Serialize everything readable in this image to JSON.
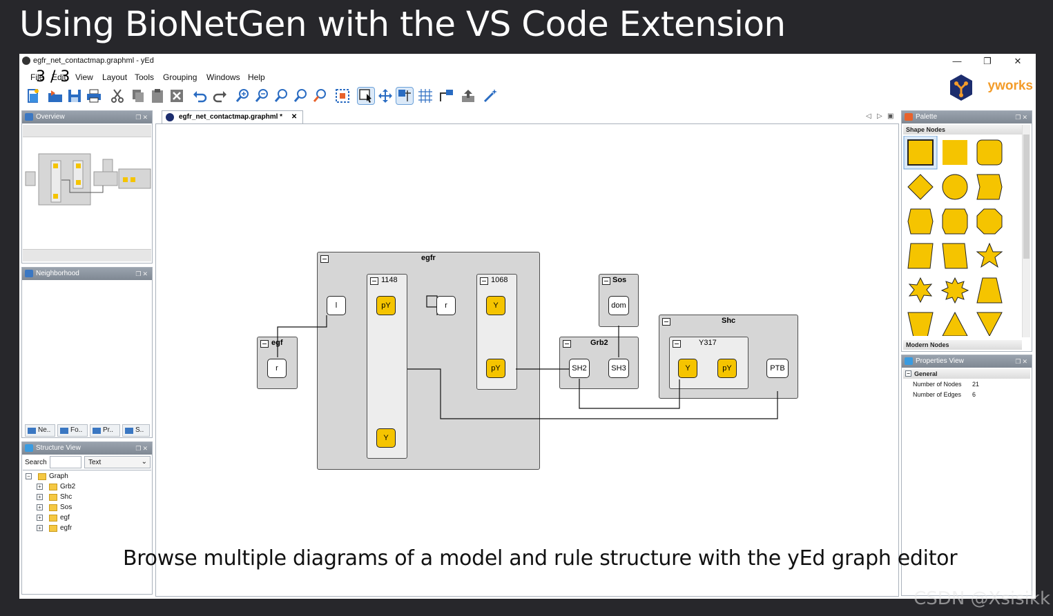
{
  "slide": {
    "title": "Using BioNetGen with the VS Code Extension",
    "page_counter": "3 / 3",
    "caption": "Browse multiple diagrams of a model and rule structure with the yEd graph editor",
    "watermark": "CSDN @Xsisikk"
  },
  "window": {
    "title": "egfr_net_contactmap.graphml - yEd",
    "controls": {
      "minimize": "—",
      "restore": "❐",
      "close": "✕"
    },
    "menus": [
      "File",
      "Edit",
      "View",
      "Layout",
      "Tools",
      "Grouping",
      "Windows",
      "Help"
    ],
    "logo_text": "yworks"
  },
  "overview_panel": {
    "title": "Overview"
  },
  "neighborhood_panel": {
    "title": "Neighborhood",
    "tabs": [
      "Ne..",
      "Fo..",
      "Pr..",
      "S.."
    ]
  },
  "structure_panel": {
    "title": "Structure View",
    "search_label": "Search",
    "search_value": "",
    "filter_selected": "Text",
    "root": "Graph",
    "items": [
      "Grb2",
      "Shc",
      "Sos",
      "egf",
      "egfr"
    ]
  },
  "document": {
    "tab_label": "egfr_net_contactmap.graphml *",
    "diagram": {
      "groups": {
        "egfr": "egfr",
        "site_1148": "1148",
        "site_1068": "1068",
        "egf": "egf",
        "sos": "Sos",
        "grb2": "Grb2",
        "shc": "Shc",
        "site_Y317": "Y317"
      },
      "nodes": {
        "egfr_l": "l",
        "egfr_1148_pY": "pY",
        "egfr_1148_Y": "Y",
        "egfr_r": "r",
        "egfr_1068_Y": "Y",
        "egfr_1068_pY": "pY",
        "egf_r": "r",
        "sos_dom": "dom",
        "grb2_SH2": "SH2",
        "grb2_SH3": "SH3",
        "shc_Y": "Y",
        "shc_pY": "pY",
        "shc_PTB": "PTB"
      }
    }
  },
  "palette_panel": {
    "title": "Palette",
    "section_shape": "Shape Nodes",
    "section_modern": "Modern Nodes",
    "shape_color": "#f5c400"
  },
  "properties_panel": {
    "title": "Properties View",
    "section": "General",
    "rows": [
      {
        "label": "Number of Nodes",
        "value": "21"
      },
      {
        "label": "Number of Edges",
        "value": "6"
      }
    ]
  },
  "colors": {
    "node_yellow": "#f5c400",
    "group_gray": "#d6d6d6",
    "panel_header": "#8a939e"
  }
}
